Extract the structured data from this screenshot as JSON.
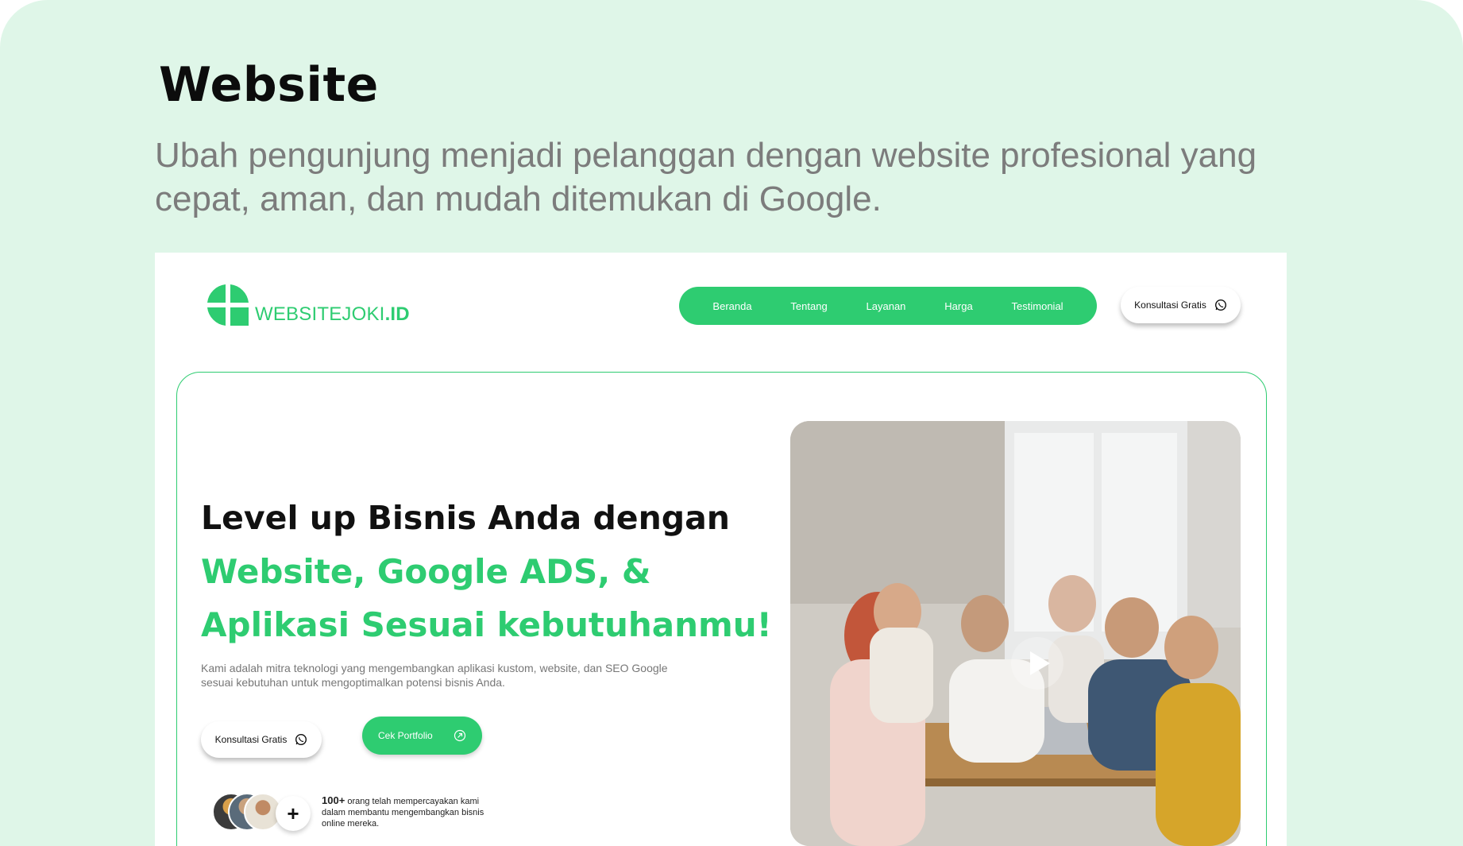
{
  "section": {
    "title": "Website",
    "subtitle": "Ubah pengunjung menjadi pelanggan dengan website profesional yang cepat, aman, dan mudah ditemukan di Google."
  },
  "site": {
    "logo": {
      "text_main": "WEBSITEJOKI",
      "text_suffix": ".ID"
    },
    "nav": [
      "Beranda",
      "Tentang",
      "Layanan",
      "Harga",
      "Testimonial"
    ],
    "header_button": "Konsultasi Gratis",
    "hero": {
      "line1": "Level up Bisnis Anda dengan",
      "line2": "Website, Google ADS, &",
      "line3": "Aplikasi Sesuai kebutuhanmu!",
      "description": "Kami adalah mitra teknologi yang mengembangkan aplikasi kustom, website, dan SEO Google sesuai kebutuhan untuk mengoptimalkan potensi bisnis  Anda.",
      "primary_button": "Konsultasi Gratis",
      "secondary_button": "Cek Portfolio",
      "trust_count": "100+",
      "trust_text": "orang telah mempercayakan kami dalam membantu mengembangkan bisnis online mereka.",
      "plus_sign": "+"
    }
  },
  "colors": {
    "brand_green": "#2ecc71",
    "card_background": "#dff6e8",
    "subtitle_gray": "#7c7c7c"
  },
  "icons": [
    "logo-mark-icon",
    "whatsapp-icon",
    "arrow-up-right-icon",
    "play-icon"
  ]
}
